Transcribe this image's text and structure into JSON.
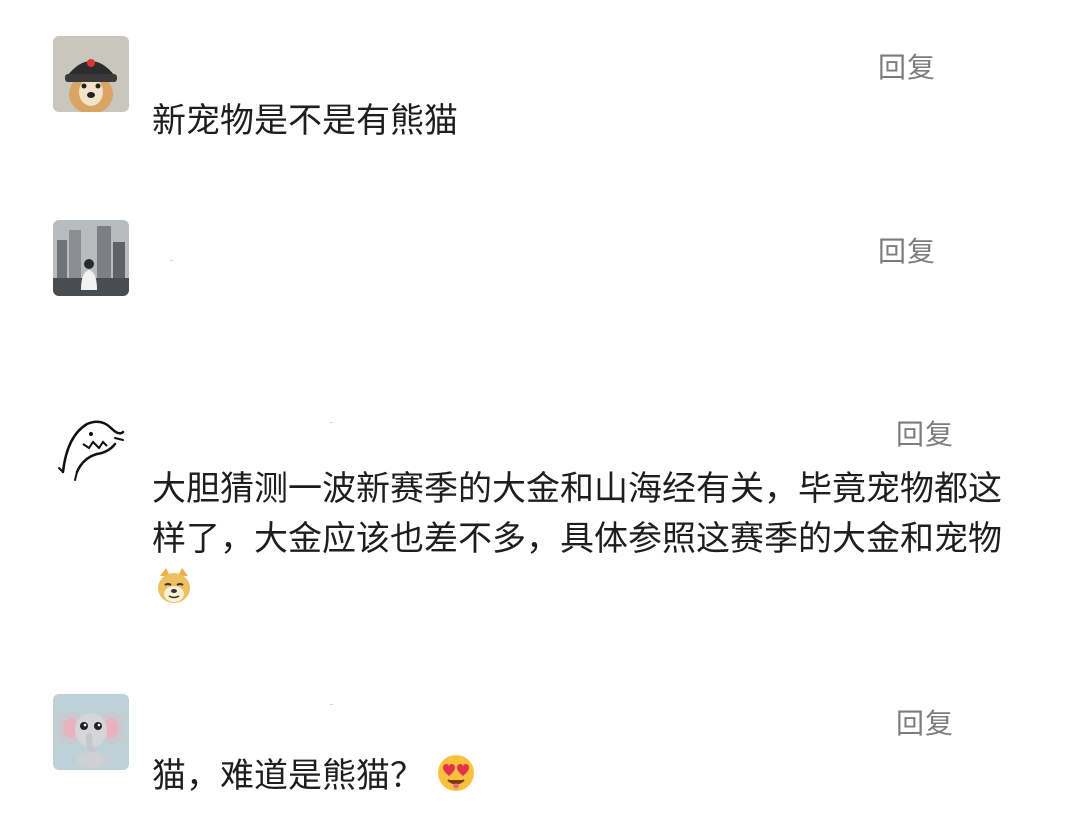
{
  "comments": [
    {
      "text": "新宠物是不是有熊猫",
      "reply_label": "回复",
      "avatar": "dog-in-hat-avatar"
    },
    {
      "text": "",
      "reply_label": "回复",
      "avatar": "city-photo-avatar"
    },
    {
      "text": "大胆猜测一波新赛季的大金和山海经有关，毕竟宠物都这样了，大金应该也差不多，具体参照这赛季的大金和宠物",
      "reply_label": "回复",
      "avatar": "shark-doodle-avatar",
      "emoji": "doge-emoji"
    },
    {
      "text": "猫，难道是熊猫？",
      "reply_label": "回复",
      "avatar": "baby-elephant-avatar",
      "emoji": "heart-eyes-emoji"
    }
  ],
  "colors": {
    "reply": "#7d7d7d",
    "text": "#1e1e1e",
    "background": "#ffffff"
  }
}
